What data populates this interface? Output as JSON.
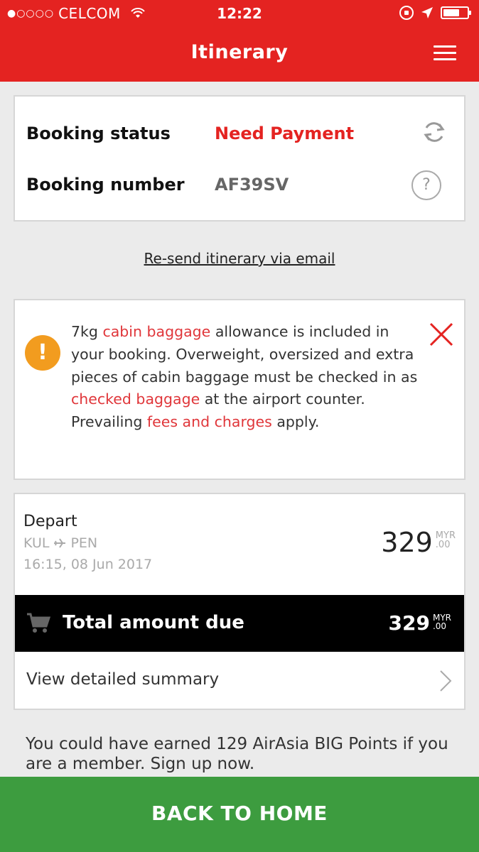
{
  "status_bar": {
    "signal_dots": "●○○○○",
    "carrier": "CELCOM",
    "time": "12:22"
  },
  "header": {
    "title": "Itinerary"
  },
  "booking": {
    "status_label": "Booking status",
    "status_value": "Need Payment",
    "number_label": "Booking number",
    "number_value": "AF39SV",
    "help_glyph": "?"
  },
  "resend_link": "Re-send itinerary via email",
  "notice": {
    "icon_glyph": "!",
    "part1": "7kg ",
    "link1": "cabin baggage",
    "part2": " allowance is included in your booking. Overweight, oversized and extra pieces of cabin baggage must be checked in as ",
    "link2": "checked baggage",
    "part3": " at the airport counter. Prevailing ",
    "link3": "fees and charges",
    "part4": " apply."
  },
  "flight": {
    "label": "Depart",
    "origin": "KUL",
    "destination": "PEN",
    "datetime": "16:15, 08 Jun 2017",
    "price": "329",
    "currency": "MYR",
    "cents": ".00"
  },
  "total": {
    "label": "Total amount due",
    "price": "329",
    "currency": "MYR",
    "cents": ".00"
  },
  "summary": {
    "label": "View detailed summary"
  },
  "points_text": "You could have earned 129 AirAsia BIG Points if you are a member. Sign up now.",
  "back_button": "BACK TO HOME",
  "colors": {
    "brand_red": "#e42321",
    "warning_orange": "#f29c1f",
    "button_green": "#3d9c3f"
  }
}
